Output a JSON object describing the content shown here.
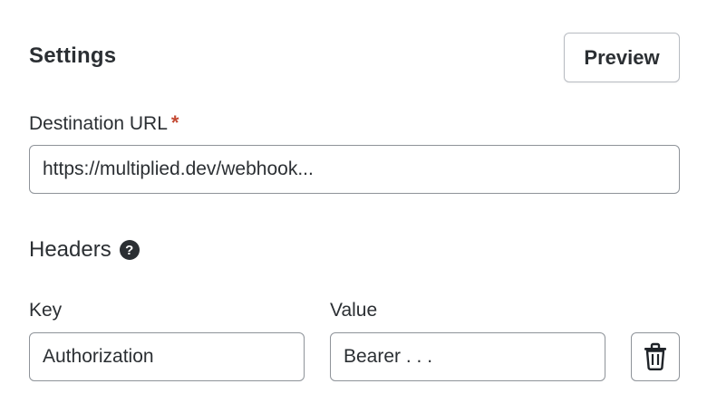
{
  "settings": {
    "title": "Settings",
    "preview_label": "Preview"
  },
  "destination": {
    "label": "Destination URL",
    "required_marker": "*",
    "value": "https://multiplied.dev/webhook..."
  },
  "headers": {
    "title": "Headers",
    "help_icon": "question-circle-icon",
    "key_label": "Key",
    "value_label": "Value",
    "rows": [
      {
        "key": "Authorization",
        "value": "Bearer . . ."
      }
    ],
    "delete_icon": "trash-icon"
  },
  "colors": {
    "required": "#c44a33",
    "text": "#2b2f33",
    "border": "#8e9399"
  }
}
